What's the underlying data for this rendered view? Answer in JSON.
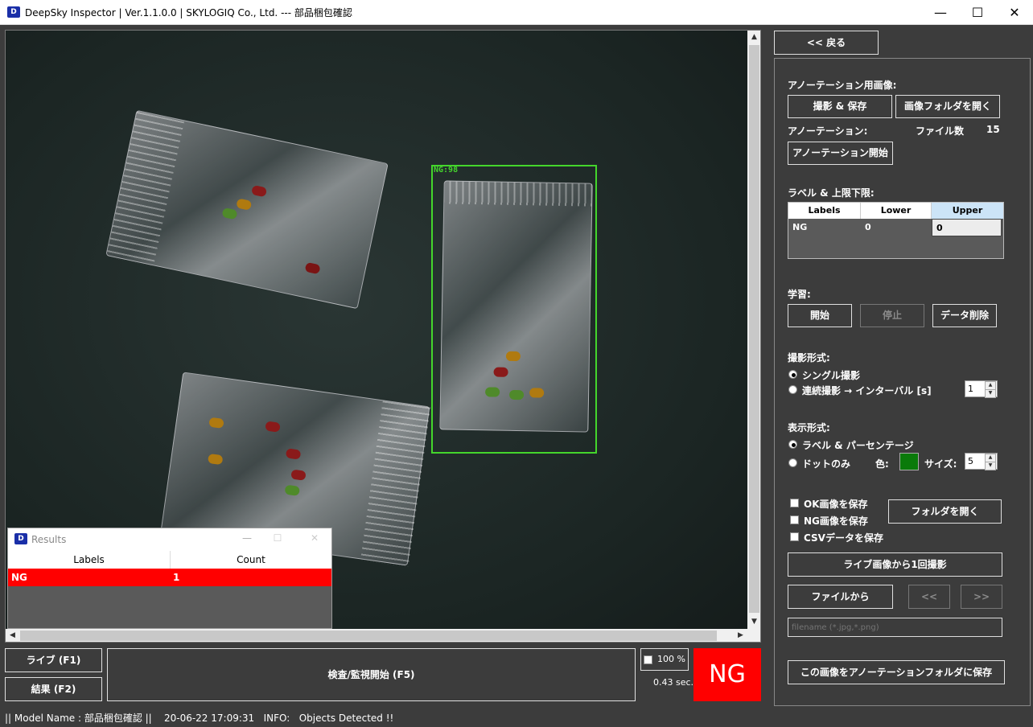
{
  "window": {
    "title": "DeepSky Inspector | Ver.1.1.0.0 | SKYLOGIQ Co., Ltd. --- 部品梱包確認",
    "minimize": "—",
    "maximize": "☐",
    "close": "✕"
  },
  "viewport": {
    "detection_label": "NG:98",
    "detection_color": "#44d62c"
  },
  "results_window": {
    "title": "Results",
    "minimize": "—",
    "maximize": "☐",
    "close": "✕",
    "columns": [
      "Labels",
      "Count"
    ],
    "rows": [
      {
        "label": "NG",
        "count": "1"
      }
    ]
  },
  "bottom": {
    "live_button": "ライブ (F1)",
    "result_button": "結果 (F2)",
    "start_button": "検査/監視開始 (F5)",
    "zoom": "100 %",
    "time": "0.43 sec.",
    "judgement": "NG",
    "judgement_color": "#ff0000"
  },
  "status_bar": {
    "text": "|| Model Name : 部品梱包確認 ||    20-06-22 17:09:31   INFO:   Objects Detected !!"
  },
  "panel": {
    "back_button": "<< 戻る",
    "annotation_image_label": "アノーテーション用画像:",
    "capture_save_button": "撮影 & 保存",
    "open_image_folder_button": "画像フォルダを開く",
    "annotation_label": "アノーテーション:",
    "file_count_label": "ファイル数",
    "file_count": "15",
    "annotation_start_button": "アノーテーション開始",
    "label_limits_label": "ラベル & 上限下限:",
    "table": {
      "columns": [
        "Labels",
        "Lower",
        "Upper"
      ],
      "rows": [
        {
          "label": "NG",
          "lower": "0",
          "upper": "0"
        }
      ]
    },
    "learning_label": "学習:",
    "learn_start_button": "開始",
    "learn_stop_button": "停止",
    "delete_data_button": "データ削除",
    "capture_mode_label": "撮影形式:",
    "single_capture": "シングル撮影",
    "continuous_capture": "連続撮影 → インターバル [s]",
    "interval_value": "1",
    "display_mode_label": "表示形式:",
    "label_percentage": "ラベル & パーセンテージ",
    "dots_only": "ドットのみ",
    "color_label": "色:",
    "dot_color": "#0a7a0a",
    "size_label": "サイズ:",
    "size_value": "5",
    "save_ok": "OK画像を保存",
    "save_ng": "NG画像を保存",
    "save_csv": "CSVデータを保存",
    "open_folder_button": "フォルダを開く",
    "capture_from_live_button": "ライブ画像から1回撮影",
    "from_file_button": "ファイルから",
    "prev_button": "<<",
    "next_button": ">>",
    "filename_placeholder": "filename (*.jpg,*.png)",
    "save_to_annotation_button": "この画像をアノーテーションフォルダに保存"
  }
}
